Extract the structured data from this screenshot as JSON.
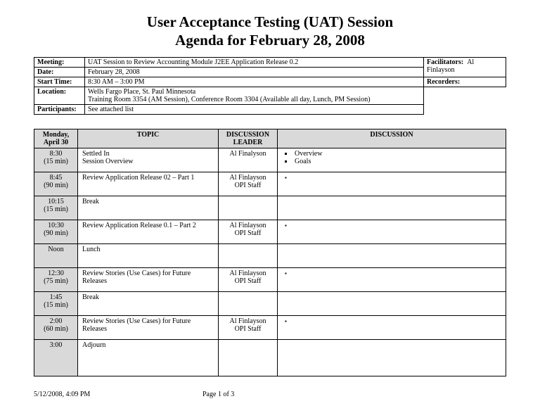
{
  "title_line1": "User Acceptance Testing (UAT) Session",
  "title_line2": "Agenda for February 28, 2008",
  "info": {
    "meeting_label": "Meeting:",
    "meeting_value": "UAT Session to Review Accounting Module J2EE Application Release 0.2",
    "date_label": "Date:",
    "date_value": "February 28, 2008",
    "start_label": "Start Time:",
    "start_value": "8:30 AM – 3:00 PM",
    "location_label": "Location:",
    "location_value1": "Wells Fargo Place, St. Paul Minnesota",
    "location_value2": "Training Room 3354 (AM Session), Conference Room 3304 (Available all day, Lunch, PM Session)",
    "participants_label": "Participants:",
    "participants_value": "See attached list",
    "facilitators_label": "Facilitators:",
    "facilitators_value": "Al Finlayson",
    "recorders_label": "Recorders:",
    "recorders_value": ""
  },
  "agenda_headers": {
    "time": "Monday, April 30",
    "topic": "TOPIC",
    "leader": "DISCUSSION LEADER",
    "discussion": "DISCUSSION"
  },
  "rows": [
    {
      "time": "8:30",
      "dur": "(15 min)",
      "topic1": "Settled In",
      "topic2": "Session Overview",
      "leader1": "Al Finalyson",
      "leader2": "",
      "bullets": [
        "Overview",
        "Goals"
      ]
    },
    {
      "time": "8:45",
      "dur": "(90 min)",
      "topic1": "Review Application Release 02 – Part 1",
      "topic2": "",
      "leader1": "Al Finlayson",
      "leader2": "OPI Staff",
      "bullets": [
        ""
      ]
    },
    {
      "time": "10:15",
      "dur": "(15 min)",
      "topic1": "Break",
      "topic2": "",
      "leader1": "",
      "leader2": "",
      "bullets": []
    },
    {
      "time": "10:30",
      "dur": "(90 min)",
      "topic1": "Review Application Release 0.1 – Part 2",
      "topic2": "",
      "leader1": "Al Finlayson",
      "leader2": "OPI Staff",
      "bullets": [
        ""
      ]
    },
    {
      "time": "Noon",
      "dur": "",
      "topic1": "Lunch",
      "topic2": "",
      "leader1": "",
      "leader2": "",
      "bullets": []
    },
    {
      "time": "12:30",
      "dur": "(75 min)",
      "topic1": "Review Stories (Use Cases) for Future Releases",
      "topic2": "",
      "leader1": "Al Finlayson",
      "leader2": "OPI Staff",
      "bullets": [
        ""
      ]
    },
    {
      "time": "1:45",
      "dur": "(15 min)",
      "topic1": "Break",
      "topic2": "",
      "leader1": "",
      "leader2": "",
      "bullets": []
    },
    {
      "time": "2:00",
      "dur": "(60 min)",
      "topic1": "Review Stories (Use Cases) for Future Releases",
      "topic2": "",
      "leader1": "Al Finlayson",
      "leader2": "OPI Staff",
      "bullets": [
        ""
      ]
    },
    {
      "time": "3:00",
      "dur": "",
      "topic1": "Adjourn",
      "topic2": "",
      "leader1": "",
      "leader2": "",
      "bullets": []
    }
  ],
  "footer": {
    "stamp": "5/12/2008, 4:09 PM",
    "pager": "Page 1 of 3"
  }
}
